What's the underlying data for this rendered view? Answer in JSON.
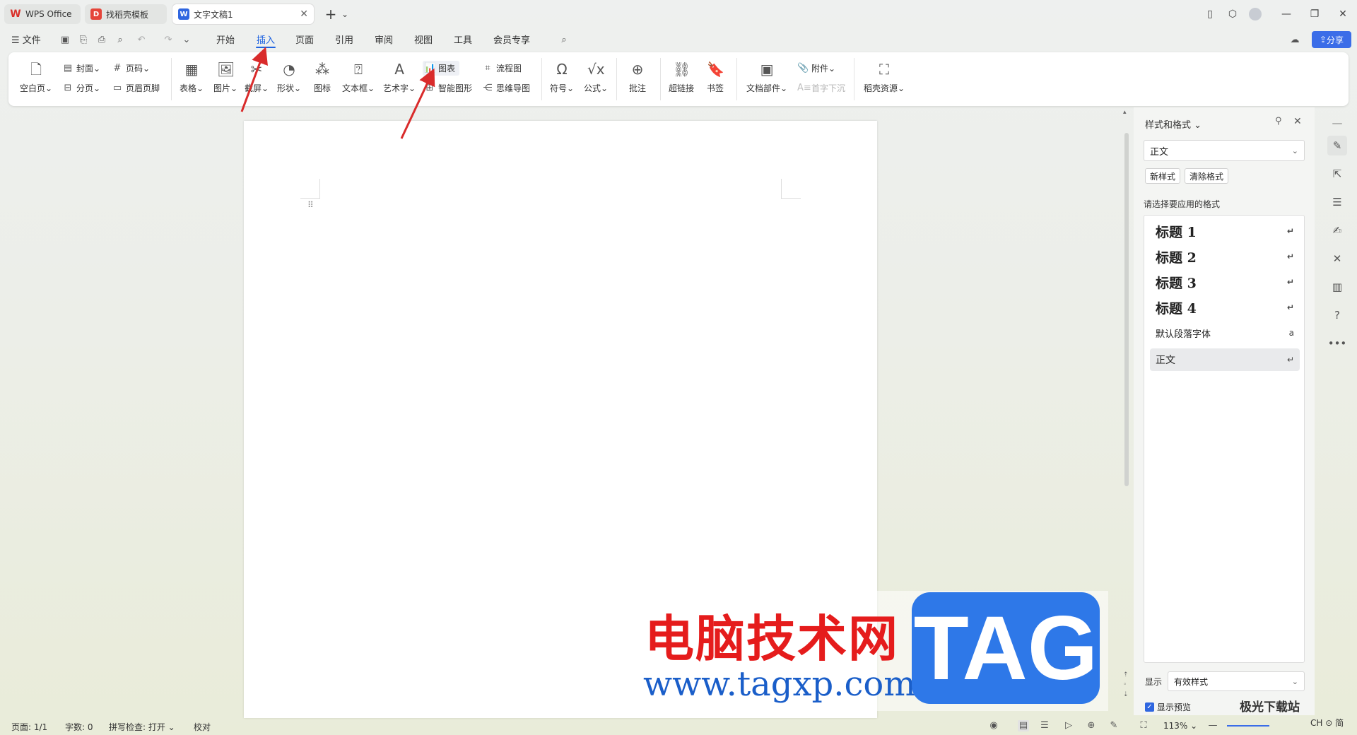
{
  "titlebar": {
    "tabs": [
      {
        "label": "WPS Office",
        "active": false
      },
      {
        "label": "找稻壳模板",
        "active": false
      },
      {
        "label": "文字文稿1",
        "active": true
      }
    ],
    "new_tab": "+",
    "tab_list": "⌄"
  },
  "menu": {
    "file_label": "文件",
    "items": [
      "开始",
      "插入",
      "页面",
      "引用",
      "审阅",
      "视图",
      "工具",
      "会员专享"
    ],
    "active": "插入",
    "share_label": "分享"
  },
  "ribbon": {
    "blank_page": "空白页",
    "cover": "封面",
    "page_break": "分页",
    "page_number": "页码",
    "header_footer": "页眉页脚",
    "table": "表格",
    "picture": "图片",
    "screenshot": "截屏",
    "shape": "形状",
    "icon": "图标",
    "textbox": "文本框",
    "wordart": "艺术字",
    "chart": "图表",
    "smart_art": "智能图形",
    "flowchart": "流程图",
    "mindmap": "思维导图",
    "symbol": "符号",
    "formula": "公式",
    "comment": "批注",
    "hyperlink": "超链接",
    "bookmark": "书签",
    "doc_parts": "文档部件",
    "attachment": "附件",
    "drop_cap": "首字下沉",
    "docer_resources": "稻壳资源"
  },
  "styles_pane": {
    "title": "样式和格式",
    "current_style": "正文",
    "new_style": "新样式",
    "clear_format": "清除格式",
    "prompt": "请选择要应用的格式",
    "styles": [
      {
        "label": "标题  1",
        "mark": "↵"
      },
      {
        "label": "标题  2",
        "mark": "↵"
      },
      {
        "label": "标题  3",
        "mark": "↵"
      },
      {
        "label": "标题  4",
        "mark": "↵"
      },
      {
        "label": "默认段落字体",
        "mark": "a"
      },
      {
        "label": "正文",
        "mark": "↵"
      }
    ],
    "show_label": "显示",
    "show_value": "有效样式",
    "preview_label": "显示预览"
  },
  "status": {
    "page": "页面: 1/1",
    "words": "字数: 0",
    "spell": "拼写检查: 打开",
    "proof": "校对",
    "zoom": "113%"
  },
  "watermark": {
    "cn_text": "电脑技术网",
    "url": "www.tagxp.com",
    "tag": "TAG",
    "corner_text": "极光下载站",
    "corner_small": "CH ⊙ 简"
  },
  "colors": {
    "accent": "#1f63e0",
    "share": "#3b6de8",
    "arrow": "#d92b2b"
  }
}
